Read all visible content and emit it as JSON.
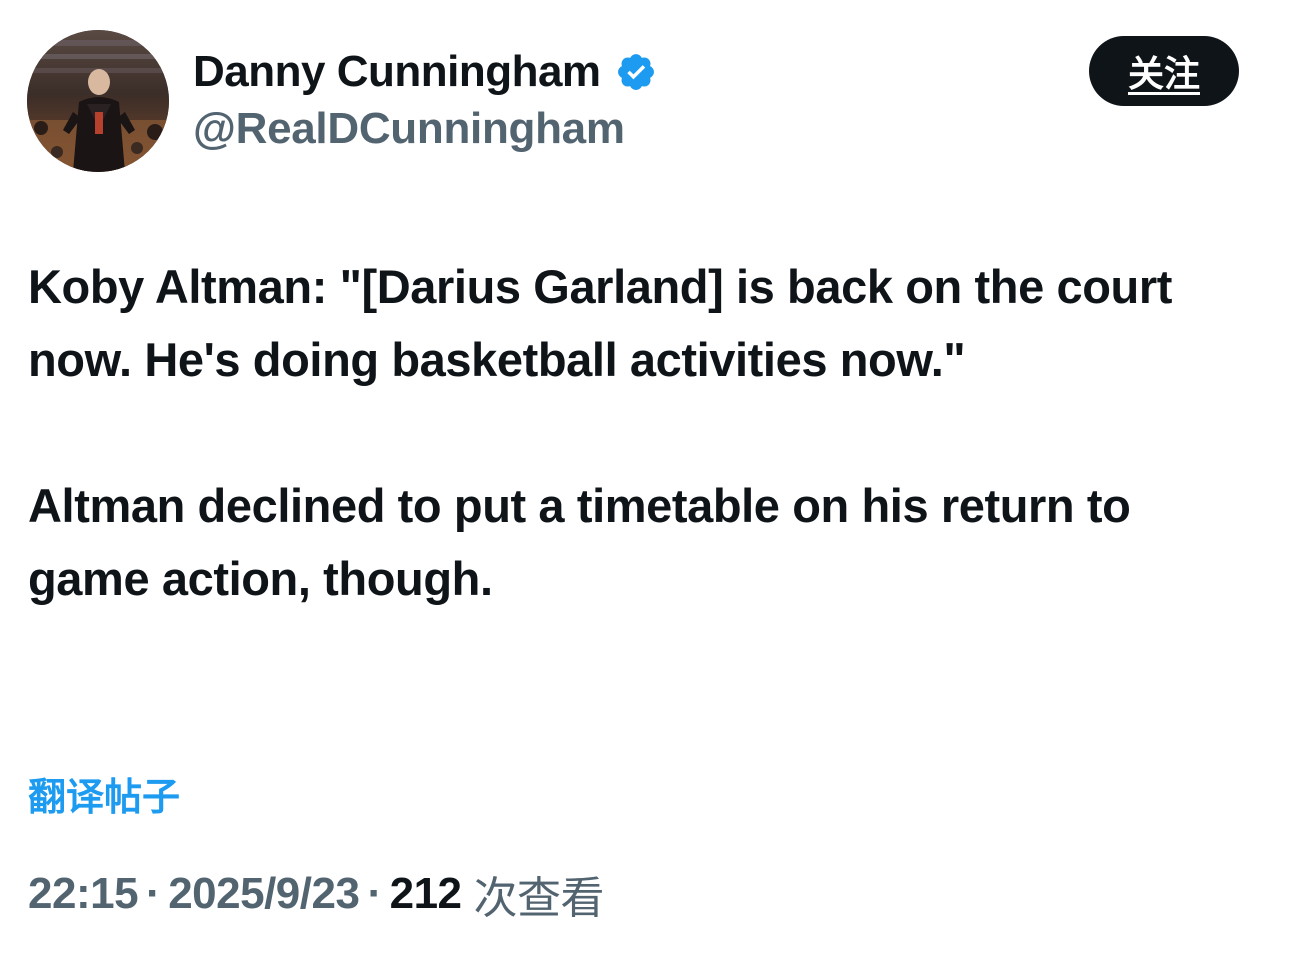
{
  "author": {
    "display_name": "Danny Cunningham",
    "handle": "@RealDCunningham",
    "verified": true,
    "verified_color": "#1d9bf0"
  },
  "follow_button": {
    "label": "关注"
  },
  "tweet": {
    "paragraphs": [
      "Koby Altman: \"[Darius Garland] is back on the court now. He's doing basketball activities now.\"",
      "Altman declined to put a timetable on his return to game action, though."
    ]
  },
  "translate_link": "翻译帖子",
  "meta": {
    "time": "22:15",
    "separator": "·",
    "date": "2025/9/23",
    "views_count": "212",
    "views_label": "次查看"
  },
  "colors": {
    "text_primary": "#0f1419",
    "text_secondary": "#536471",
    "accent": "#1d9bf0",
    "button_bg": "#0f1419"
  },
  "icons": {
    "avatar": "profile-photo",
    "verified": "verified-badge-icon"
  }
}
